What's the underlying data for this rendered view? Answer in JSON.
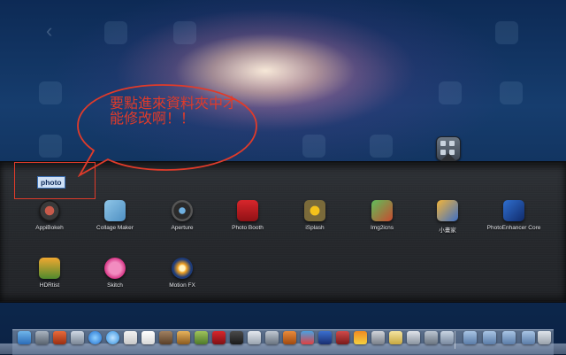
{
  "annotation": {
    "text": "要點進來資料夾中才能修改啊！！"
  },
  "folder": {
    "name": "photo",
    "apps": [
      {
        "label": "AppiBokeh",
        "icon": "appibokeh-icon"
      },
      {
        "label": "Collage Maker",
        "icon": "collage-maker-icon"
      },
      {
        "label": "Aperture",
        "icon": "aperture-icon"
      },
      {
        "label": "Photo Booth",
        "icon": "photo-booth-icon"
      },
      {
        "label": "iSplash",
        "icon": "isplash-icon"
      },
      {
        "label": "Img2icns",
        "icon": "img2icns-icon"
      },
      {
        "label": "小畫家",
        "icon": "paint-icon"
      },
      {
        "label": "PhotoEnhancer Core",
        "icon": "photoenhancer-icon"
      },
      {
        "label": "HDRtist",
        "icon": "hdrtist-icon"
      },
      {
        "label": "Skitch",
        "icon": "skitch-icon"
      },
      {
        "label": "Motion FX",
        "icon": "motion-fx-icon"
      }
    ]
  },
  "colors": {
    "annotation": "#e03b2a",
    "selection": "#cfe0f5"
  }
}
